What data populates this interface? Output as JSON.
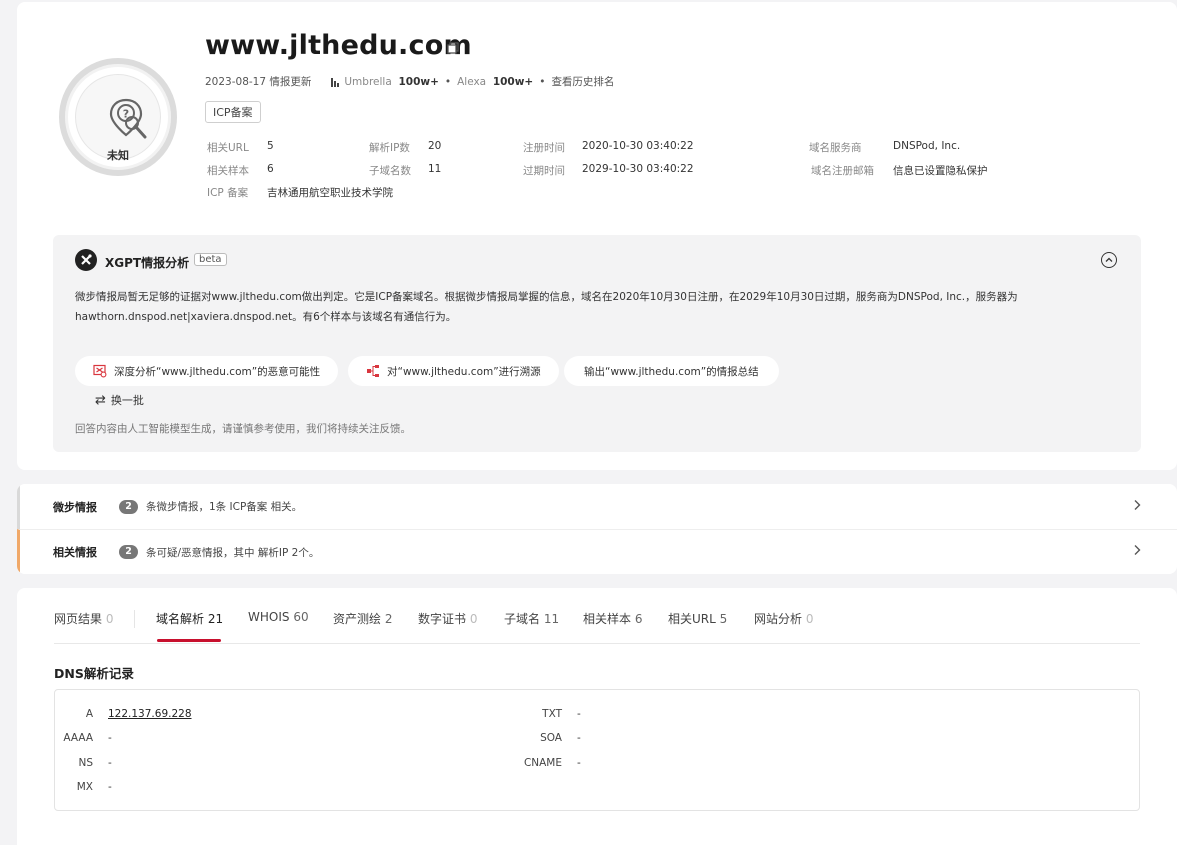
{
  "header": {
    "domain": "www.jlthedu.com",
    "avatar_label": "未知",
    "update_date": "2023-08-17",
    "update_label": "情报更新",
    "umbrella_label": "Umbrella",
    "umbrella_value": "100w+",
    "alexa_label": "Alexa",
    "alexa_value": "100w+",
    "history_rank": "查看历史排名",
    "icp_tag": "ICP备案"
  },
  "info": {
    "related_url_label": "相关URL",
    "related_url_value": "5",
    "resolve_ip_label": "解析IP数",
    "resolve_ip_value": "20",
    "reg_time_label": "注册时间",
    "reg_time_value": "2020-10-30 03:40:22",
    "registrar_label": "域名服务商",
    "registrar_value": "DNSPod, Inc.",
    "related_sample_label": "相关样本",
    "related_sample_value": "6",
    "subdomain_label": "子域名数",
    "subdomain_value": "11",
    "expire_label": "过期时间",
    "expire_value": "2029-10-30 03:40:22",
    "reg_email_label": "域名注册邮箱",
    "reg_email_value": "信息已设置隐私保护",
    "icp_label": "ICP 备案",
    "icp_value": "吉林通用航空职业技术学院"
  },
  "xgpt": {
    "title": "XGPT情报分析",
    "beta": "beta",
    "text_line1": "微步情报局暂无足够的证据对www.jlthedu.com做出判定。它是ICP备案域名。根据微步情报局掌握的信息，域名在2020年10月30日注册，在2029年10月30日过期，服务商为DNSPod, Inc.，服务器为",
    "text_line2": "hawthorn.dnspod.net|xaviera.dnspod.net。有6个样本与该域名有通信行为。",
    "pill1": "深度分析“www.jlthedu.com”的恶意可能性",
    "pill2": "对“www.jlthedu.com”进行溯源",
    "pill3": "输出“www.jlthedu.com”的情报总结",
    "refresh": "换一批",
    "disclaimer": "回答内容由人工智能模型生成，请谨慎参考使用，我们将持续关注反馈。"
  },
  "intel": {
    "weibu_name": "微步情报",
    "weibu_count": "2",
    "weibu_desc": "条微步情报，1条 ICP备案 相关。",
    "related_name": "相关情报",
    "related_count": "2",
    "related_desc": "条可疑/恶意情报，其中 解析IP 2个。"
  },
  "tabs": [
    {
      "label": "网页结果",
      "count": "0"
    },
    {
      "label": "域名解析",
      "count": "21"
    },
    {
      "label": "WHOIS",
      "count": "60"
    },
    {
      "label": "资产测绘",
      "count": "2"
    },
    {
      "label": "数字证书",
      "count": "0"
    },
    {
      "label": "子域名",
      "count": "11"
    },
    {
      "label": "相关样本",
      "count": "6"
    },
    {
      "label": "相关URL",
      "count": "5"
    },
    {
      "label": "网站分析",
      "count": "0"
    }
  ],
  "dns": {
    "title": "DNS解析记录",
    "a_label": "A",
    "a_value": "122.137.69.228",
    "aaaa_label": "AAAA",
    "aaaa_value": "-",
    "ns_label": "NS",
    "ns_value": "-",
    "mx_label": "MX",
    "mx_value": "-",
    "txt_label": "TXT",
    "txt_value": "-",
    "soa_label": "SOA",
    "soa_value": "-",
    "cname_label": "CNAME",
    "cname_value": "-"
  },
  "colors": {
    "accent_red": "#c8102e",
    "related_bar": "#f0a868"
  }
}
